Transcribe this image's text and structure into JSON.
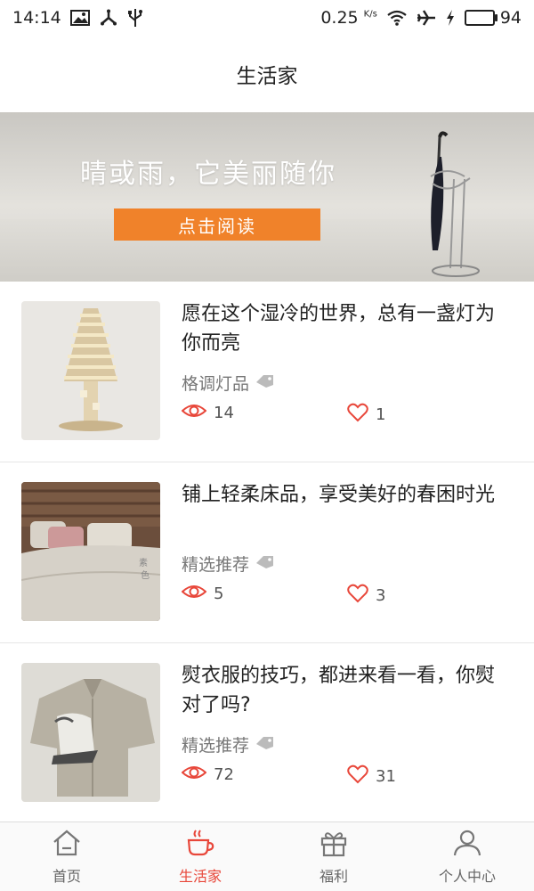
{
  "status_bar": {
    "time": "14:14",
    "net_speed": "0.25",
    "net_unit": "K/s",
    "battery": "94",
    "battery_level": 0.94,
    "icons": [
      "image-icon",
      "share-icon",
      "usb-icon",
      "wifi-icon",
      "airplane-icon",
      "charging-icon",
      "battery-icon"
    ]
  },
  "header": {
    "title": "生活家"
  },
  "banner": {
    "headline": "晴或雨，它美丽随你",
    "button_label": "点击阅读",
    "button_color": "#f0822a"
  },
  "feed": [
    {
      "title": "愿在这个湿冷的世界，总有一盏灯为你而亮",
      "tag": "格调灯品",
      "views": "14",
      "likes": "1",
      "thumb": "lamp"
    },
    {
      "title": "铺上轻柔床品，享受美好的春困时光",
      "tag": "精选推荐",
      "views": "5",
      "likes": "3",
      "thumb": "bed",
      "thumb_text": [
        "素",
        "色"
      ]
    },
    {
      "title": "熨衣服的技巧，都进来看一看，你熨对了吗?",
      "tag": "精选推荐",
      "views": "72",
      "likes": "31",
      "thumb": "iron"
    }
  ],
  "tabs": [
    {
      "label": "首页",
      "icon": "home-icon",
      "active": false
    },
    {
      "label": "生活家",
      "icon": "cup-icon",
      "active": true
    },
    {
      "label": "福利",
      "icon": "gift-icon",
      "active": false
    },
    {
      "label": "个人中心",
      "icon": "user-icon",
      "active": false
    }
  ],
  "colors": {
    "accent": "#e8473a",
    "icon_red": "#e8473a"
  }
}
